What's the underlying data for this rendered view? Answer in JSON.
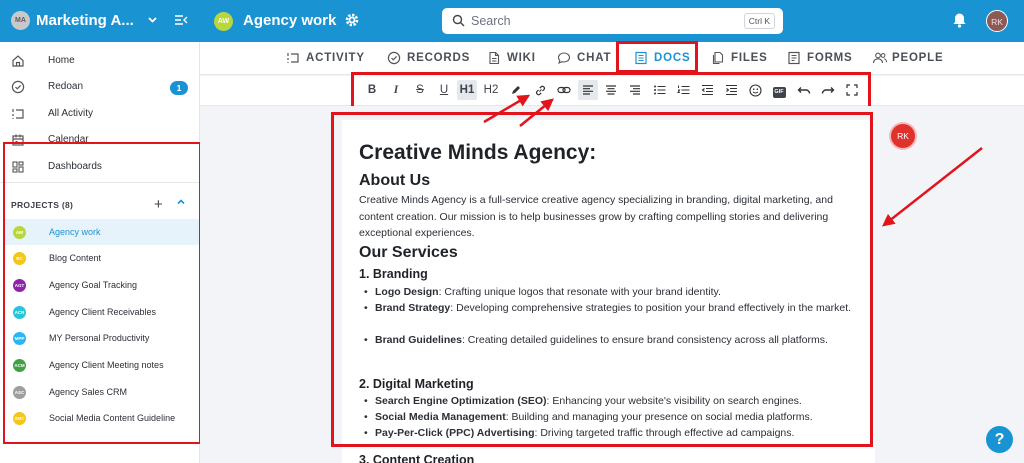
{
  "header": {
    "workspace_initials": "MA",
    "workspace_name": "Marketing A...",
    "project_initials": "AW",
    "project_name": "Agency work",
    "search_placeholder": "Search",
    "search_shortcut": "Ctrl K",
    "user_initials": "RK"
  },
  "sidebar": {
    "nav": [
      {
        "label": "Home",
        "icon": "home-icon"
      },
      {
        "label": "Redoan",
        "icon": "check-circle-icon",
        "badge": "1"
      },
      {
        "label": "All Activity",
        "icon": "activity-icon"
      },
      {
        "label": "Calendar",
        "icon": "calendar-icon"
      },
      {
        "label": "Dashboards",
        "icon": "dashboard-icon"
      }
    ],
    "projects_header": "PROJECTS (8)",
    "projects": [
      {
        "initials": "AW",
        "label": "Agency work",
        "color": "#b9d63d",
        "active": true
      },
      {
        "initials": "BC",
        "label": "Blog Content",
        "color": "#f5c518"
      },
      {
        "initials": "AGT",
        "label": "Agency Goal Tracking",
        "color": "#8e24aa"
      },
      {
        "initials": "ACR",
        "label": "Agency Client Receivables",
        "color": "#26c6da"
      },
      {
        "initials": "MPP",
        "label": "MY Personal Productivity",
        "color": "#29b6f6"
      },
      {
        "initials": "ACM",
        "label": "Agency Client Meeting notes",
        "color": "#43a047"
      },
      {
        "initials": "ASC",
        "label": "Agency Sales CRM",
        "color": "#9e9e9e"
      },
      {
        "initials": "SMC",
        "label": "Social Media Content Guideline",
        "color": "#f5c518"
      }
    ]
  },
  "tabs": [
    {
      "label": "ACTIVITY",
      "icon": "activity-icon"
    },
    {
      "label": "RECORDS",
      "icon": "check-circle-icon"
    },
    {
      "label": "WIKI",
      "icon": "file-icon"
    },
    {
      "label": "CHAT",
      "icon": "chat-icon"
    },
    {
      "label": "DOCS",
      "icon": "docs-icon",
      "active": true
    },
    {
      "label": "FILES",
      "icon": "files-icon"
    },
    {
      "label": "FORMS",
      "icon": "forms-icon"
    },
    {
      "label": "PEOPLE",
      "icon": "people-icon"
    }
  ],
  "toolbar": {
    "bold": "B",
    "italic": "I",
    "strike": "S",
    "underline": "U",
    "h1": "H1",
    "h2": "H2",
    "gif": "GIF"
  },
  "document": {
    "title": "Creative Minds Agency:",
    "about_heading": "About Us",
    "about_text": "Creative Minds Agency is a full-service creative agency specializing in branding, digital marketing, and content creation. Our mission is to help businesses grow by crafting compelling stories and delivering exceptional experiences.",
    "services_heading": "Our Services",
    "branding_heading": "1. Branding",
    "branding_items": [
      {
        "term": "Logo Design",
        "desc": ": Crafting unique logos that resonate with your brand identity."
      },
      {
        "term": "Brand Strategy",
        "desc": ": Developing comprehensive strategies to position your brand effectively in the market."
      },
      {
        "term": "Brand Guidelines",
        "desc": ": Creating detailed guidelines to ensure brand consistency across all platforms."
      }
    ],
    "digital_heading": "2. Digital Marketing",
    "digital_items": [
      {
        "term": "Search Engine Optimization (SEO)",
        "desc": ": Enhancing your website's visibility on search engines."
      },
      {
        "term": "Social Media Management",
        "desc": ": Building and managing your presence on social media platforms."
      },
      {
        "term": "Pay-Per-Click (PPC) Advertising",
        "desc": ": Driving targeted traffic through effective ad campaigns."
      }
    ],
    "content_heading": "3. Content Creation"
  },
  "collaborator_initials": "RK",
  "help_label": "?",
  "colors": {
    "brand": "#1a93d2",
    "highlight": "#e2141b"
  }
}
